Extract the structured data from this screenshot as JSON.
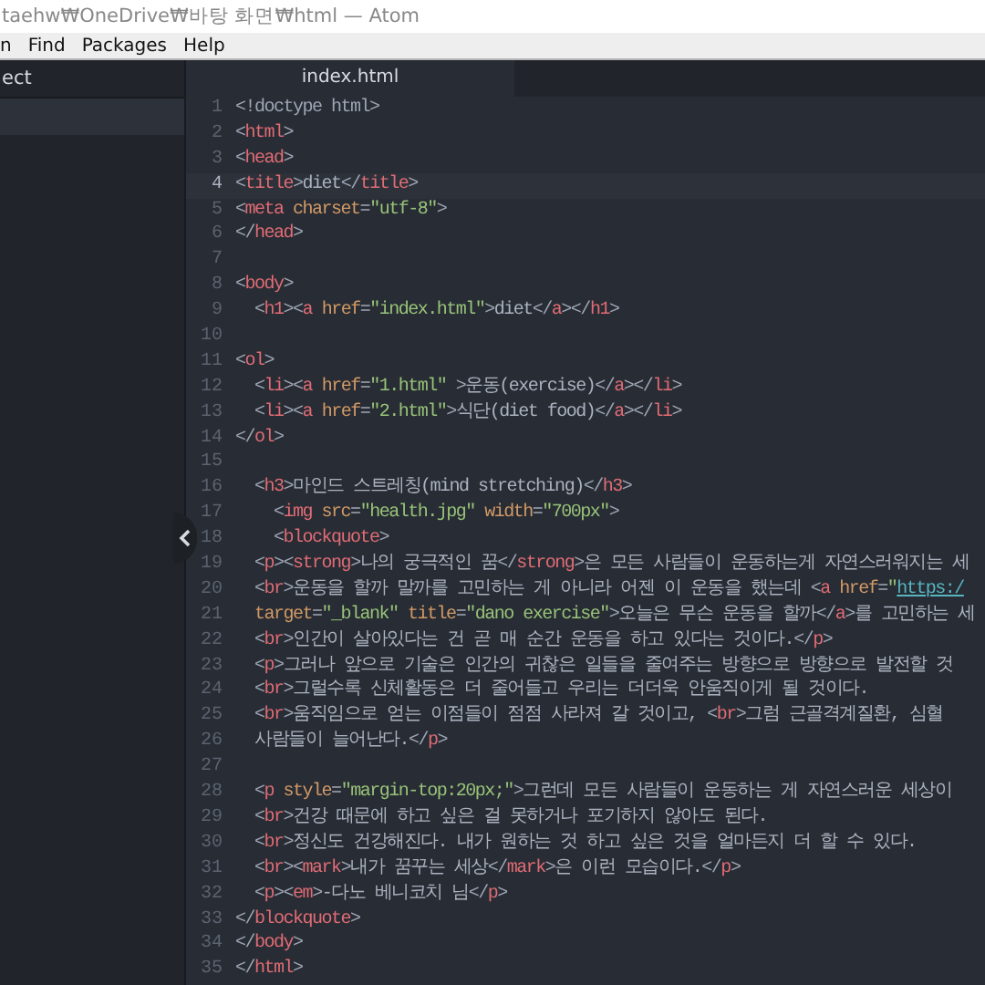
{
  "window": {
    "title": "taehw₩OneDrive₩바탕 화면₩html — Atom"
  },
  "menu": [
    "n",
    "Find",
    "Packages",
    "Help"
  ],
  "sidebar": {
    "header": "ect",
    "items": [
      {
        "selected": true
      }
    ]
  },
  "tabs": [
    {
      "label": "index.html",
      "selected": true
    }
  ],
  "editor": {
    "lines": [
      {
        "number": "1",
        "current": false,
        "tokens": [
          {
            "kind": "punct",
            "text": "<!doctype html>"
          }
        ]
      },
      {
        "number": "2",
        "current": false,
        "tokens": [
          {
            "kind": "punct",
            "text": "<"
          },
          {
            "kind": "tag",
            "text": "html"
          },
          {
            "kind": "punct",
            "text": ">"
          }
        ]
      },
      {
        "number": "3",
        "current": false,
        "tokens": [
          {
            "kind": "punct",
            "text": "<"
          },
          {
            "kind": "tag",
            "text": "head"
          },
          {
            "kind": "punct",
            "text": ">"
          }
        ]
      },
      {
        "number": "4",
        "current": true,
        "tokens": [
          {
            "kind": "punct",
            "text": "<"
          },
          {
            "kind": "tag",
            "text": "title"
          },
          {
            "kind": "punct",
            "text": ">"
          },
          {
            "kind": "text",
            "text": "diet"
          },
          {
            "kind": "punct",
            "text": "</"
          },
          {
            "kind": "tag",
            "text": "title"
          },
          {
            "kind": "punct",
            "text": ">"
          }
        ]
      },
      {
        "number": "5",
        "current": false,
        "tokens": [
          {
            "kind": "punct",
            "text": "<"
          },
          {
            "kind": "tag",
            "text": "meta"
          },
          {
            "kind": "attr",
            "text": " charset"
          },
          {
            "kind": "punct",
            "text": "="
          },
          {
            "kind": "string",
            "text": "\"utf-8\""
          },
          {
            "kind": "punct",
            "text": ">"
          }
        ]
      },
      {
        "number": "6",
        "current": false,
        "tokens": [
          {
            "kind": "punct",
            "text": "</"
          },
          {
            "kind": "tag",
            "text": "head"
          },
          {
            "kind": "punct",
            "text": ">"
          }
        ]
      },
      {
        "number": "7",
        "current": false
      },
      {
        "number": "8",
        "current": false,
        "tokens": [
          {
            "kind": "punct",
            "text": "<"
          },
          {
            "kind": "tag",
            "text": "body"
          },
          {
            "kind": "punct",
            "text": ">"
          }
        ]
      },
      {
        "number": "9",
        "current": false,
        "tokens": [
          {
            "kind": "punct",
            "text": "  <"
          },
          {
            "kind": "tag",
            "text": "h1"
          },
          {
            "kind": "punct",
            "text": "><"
          },
          {
            "kind": "tag",
            "text": "a"
          },
          {
            "kind": "attr",
            "text": " href"
          },
          {
            "kind": "punct",
            "text": "="
          },
          {
            "kind": "string",
            "text": "\"index.html\""
          },
          {
            "kind": "punct",
            "text": ">"
          },
          {
            "kind": "text",
            "text": "diet"
          },
          {
            "kind": "punct",
            "text": "</"
          },
          {
            "kind": "tag",
            "text": "a"
          },
          {
            "kind": "punct",
            "text": "></"
          },
          {
            "kind": "tag",
            "text": "h1"
          },
          {
            "kind": "punct",
            "text": ">"
          }
        ]
      },
      {
        "number": "10",
        "current": false
      },
      {
        "number": "11",
        "current": false,
        "tokens": [
          {
            "kind": "punct",
            "text": "<"
          },
          {
            "kind": "tag",
            "text": "ol"
          },
          {
            "kind": "punct",
            "text": ">"
          }
        ]
      },
      {
        "number": "12",
        "current": false,
        "tokens": [
          {
            "kind": "punct",
            "text": "  <"
          },
          {
            "kind": "tag",
            "text": "li"
          },
          {
            "kind": "punct",
            "text": "><"
          },
          {
            "kind": "tag",
            "text": "a"
          },
          {
            "kind": "attr",
            "text": " href"
          },
          {
            "kind": "punct",
            "text": "="
          },
          {
            "kind": "string",
            "text": "\"1.html\""
          },
          {
            "kind": "punct",
            "text": " >"
          },
          {
            "kind": "text",
            "text": "운동(exercise)"
          },
          {
            "kind": "punct",
            "text": "</"
          },
          {
            "kind": "tag",
            "text": "a"
          },
          {
            "kind": "punct",
            "text": "></"
          },
          {
            "kind": "tag",
            "text": "li"
          },
          {
            "kind": "punct",
            "text": ">"
          }
        ]
      },
      {
        "number": "13",
        "current": false,
        "tokens": [
          {
            "kind": "punct",
            "text": "  <"
          },
          {
            "kind": "tag",
            "text": "li"
          },
          {
            "kind": "punct",
            "text": "><"
          },
          {
            "kind": "tag",
            "text": "a"
          },
          {
            "kind": "attr",
            "text": " href"
          },
          {
            "kind": "punct",
            "text": "="
          },
          {
            "kind": "string",
            "text": "\"2.html\""
          },
          {
            "kind": "punct",
            "text": ">"
          },
          {
            "kind": "text",
            "text": "식단(diet food)"
          },
          {
            "kind": "punct",
            "text": "</"
          },
          {
            "kind": "tag",
            "text": "a"
          },
          {
            "kind": "punct",
            "text": "></"
          },
          {
            "kind": "tag",
            "text": "li"
          },
          {
            "kind": "punct",
            "text": ">"
          }
        ]
      },
      {
        "number": "14",
        "current": false,
        "tokens": [
          {
            "kind": "punct",
            "text": "</"
          },
          {
            "kind": "tag",
            "text": "ol"
          },
          {
            "kind": "punct",
            "text": ">"
          }
        ]
      },
      {
        "number": "15",
        "current": false
      },
      {
        "number": "16",
        "current": false,
        "tokens": [
          {
            "kind": "punct",
            "text": "  <"
          },
          {
            "kind": "tag",
            "text": "h3"
          },
          {
            "kind": "punct",
            "text": ">"
          },
          {
            "kind": "text",
            "text": "마인드 스트레칭(mind stretching)"
          },
          {
            "kind": "punct",
            "text": "</"
          },
          {
            "kind": "tag",
            "text": "h3"
          },
          {
            "kind": "punct",
            "text": ">"
          }
        ]
      },
      {
        "number": "17",
        "current": false,
        "tokens": [
          {
            "kind": "punct",
            "text": "    <"
          },
          {
            "kind": "tag",
            "text": "img"
          },
          {
            "kind": "attr",
            "text": " src"
          },
          {
            "kind": "punct",
            "text": "="
          },
          {
            "kind": "string",
            "text": "\"health.jpg\""
          },
          {
            "kind": "attr",
            "text": " width"
          },
          {
            "kind": "punct",
            "text": "="
          },
          {
            "kind": "string",
            "text": "\"700px\""
          },
          {
            "kind": "punct",
            "text": ">"
          }
        ]
      },
      {
        "number": "18",
        "current": false,
        "tokens": [
          {
            "kind": "punct",
            "text": "    <"
          },
          {
            "kind": "tag",
            "text": "blockquote"
          },
          {
            "kind": "punct",
            "text": ">"
          }
        ]
      },
      {
        "number": "19",
        "current": false,
        "tokens": [
          {
            "kind": "punct",
            "text": "  <"
          },
          {
            "kind": "tag",
            "text": "p"
          },
          {
            "kind": "punct",
            "text": "><"
          },
          {
            "kind": "tag",
            "text": "strong"
          },
          {
            "kind": "punct",
            "text": ">"
          },
          {
            "kind": "text",
            "text": "나의 궁극적인 꿈"
          },
          {
            "kind": "punct",
            "text": "</"
          },
          {
            "kind": "tag",
            "text": "strong"
          },
          {
            "kind": "punct",
            "text": ">"
          },
          {
            "kind": "text",
            "text": "은 모든 사람들이 운동하는게 자연스러워지는 세"
          }
        ]
      },
      {
        "number": "20",
        "current": false,
        "tokens": [
          {
            "kind": "punct",
            "text": "  <"
          },
          {
            "kind": "tag",
            "text": "br"
          },
          {
            "kind": "punct",
            "text": ">"
          },
          {
            "kind": "text",
            "text": "운동을 할까 말까를 고민하는 게 아니라 어젠 이 운동을 했는데 "
          },
          {
            "kind": "punct",
            "text": "<"
          },
          {
            "kind": "tag",
            "text": "a"
          },
          {
            "kind": "attr",
            "text": " href"
          },
          {
            "kind": "punct",
            "text": "="
          },
          {
            "kind": "string",
            "text": "\""
          },
          {
            "kind": "link",
            "text": "https:/"
          }
        ]
      },
      {
        "number": "21",
        "current": false,
        "tokens": [
          {
            "kind": "attr",
            "text": "  target"
          },
          {
            "kind": "punct",
            "text": "="
          },
          {
            "kind": "string",
            "text": "\"_blank\""
          },
          {
            "kind": "attr",
            "text": " title"
          },
          {
            "kind": "punct",
            "text": "="
          },
          {
            "kind": "string",
            "text": "\"dano exercise\""
          },
          {
            "kind": "punct",
            "text": ">"
          },
          {
            "kind": "text",
            "text": "오늘은 무슨 운동을 할까"
          },
          {
            "kind": "punct",
            "text": "</"
          },
          {
            "kind": "tag",
            "text": "a"
          },
          {
            "kind": "punct",
            "text": ">"
          },
          {
            "kind": "text",
            "text": "를 고민하는 세"
          }
        ]
      },
      {
        "number": "22",
        "current": false,
        "tokens": [
          {
            "kind": "punct",
            "text": "  <"
          },
          {
            "kind": "tag",
            "text": "br"
          },
          {
            "kind": "punct",
            "text": ">"
          },
          {
            "kind": "text",
            "text": "인간이 살아있다는 건 곧 매 순간 운동을 하고 있다는 것이다."
          },
          {
            "kind": "punct",
            "text": "</"
          },
          {
            "kind": "tag",
            "text": "p"
          },
          {
            "kind": "punct",
            "text": ">"
          }
        ]
      },
      {
        "number": "23",
        "current": false,
        "tokens": [
          {
            "kind": "punct",
            "text": "  <"
          },
          {
            "kind": "tag",
            "text": "p"
          },
          {
            "kind": "punct",
            "text": ">"
          },
          {
            "kind": "text",
            "text": "그러나 앞으로 기술은 인간의 귀찮은 일들을 줄여주는 방향으로 방향으로 발전할 것"
          }
        ]
      },
      {
        "number": "24",
        "current": false,
        "tokens": [
          {
            "kind": "punct",
            "text": "  <"
          },
          {
            "kind": "tag",
            "text": "br"
          },
          {
            "kind": "punct",
            "text": ">"
          },
          {
            "kind": "text",
            "text": "그럴수록 신체활동은 더 줄어들고 우리는 더더욱 안움직이게 될 것이다."
          }
        ]
      },
      {
        "number": "25",
        "current": false,
        "tokens": [
          {
            "kind": "punct",
            "text": "  <"
          },
          {
            "kind": "tag",
            "text": "br"
          },
          {
            "kind": "punct",
            "text": ">"
          },
          {
            "kind": "text",
            "text": "움직임으로 얻는 이점들이 점점 사라져 갈 것이고, "
          },
          {
            "kind": "punct",
            "text": "<"
          },
          {
            "kind": "tag",
            "text": "br"
          },
          {
            "kind": "punct",
            "text": ">"
          },
          {
            "kind": "text",
            "text": "그럼 근골격계질환, 심혈"
          }
        ]
      },
      {
        "number": "26",
        "current": false,
        "tokens": [
          {
            "kind": "text",
            "text": "  사람들이 늘어난다."
          },
          {
            "kind": "punct",
            "text": "</"
          },
          {
            "kind": "tag",
            "text": "p"
          },
          {
            "kind": "punct",
            "text": ">"
          }
        ]
      },
      {
        "number": "27",
        "current": false
      },
      {
        "number": "28",
        "current": false,
        "tokens": [
          {
            "kind": "punct",
            "text": "  <"
          },
          {
            "kind": "tag",
            "text": "p"
          },
          {
            "kind": "attr",
            "text": " style"
          },
          {
            "kind": "punct",
            "text": "="
          },
          {
            "kind": "string",
            "text": "\"margin-top:20px;\""
          },
          {
            "kind": "punct",
            "text": ">"
          },
          {
            "kind": "text",
            "text": "그런데 모든 사람들이 운동하는 게 자연스러운 세상이"
          }
        ]
      },
      {
        "number": "29",
        "current": false,
        "tokens": [
          {
            "kind": "punct",
            "text": "  <"
          },
          {
            "kind": "tag",
            "text": "br"
          },
          {
            "kind": "punct",
            "text": ">"
          },
          {
            "kind": "text",
            "text": "건강 때문에 하고 싶은 걸 못하거나 포기하지 않아도 된다."
          }
        ]
      },
      {
        "number": "30",
        "current": false,
        "tokens": [
          {
            "kind": "punct",
            "text": "  <"
          },
          {
            "kind": "tag",
            "text": "br"
          },
          {
            "kind": "punct",
            "text": ">"
          },
          {
            "kind": "text",
            "text": "정신도 건강해진다. 내가 원하는 것 하고 싶은 것을 얼마든지 더 할 수 있다."
          }
        ]
      },
      {
        "number": "31",
        "current": false,
        "tokens": [
          {
            "kind": "punct",
            "text": "  <"
          },
          {
            "kind": "tag",
            "text": "br"
          },
          {
            "kind": "punct",
            "text": "><"
          },
          {
            "kind": "tag",
            "text": "mark"
          },
          {
            "kind": "punct",
            "text": ">"
          },
          {
            "kind": "text",
            "text": "내가 꿈꾸는 세상"
          },
          {
            "kind": "punct",
            "text": "</"
          },
          {
            "kind": "tag",
            "text": "mark"
          },
          {
            "kind": "punct",
            "text": ">"
          },
          {
            "kind": "text",
            "text": "은 이런 모습이다."
          },
          {
            "kind": "punct",
            "text": "</"
          },
          {
            "kind": "tag",
            "text": "p"
          },
          {
            "kind": "punct",
            "text": ">"
          }
        ]
      },
      {
        "number": "32",
        "current": false,
        "tokens": [
          {
            "kind": "punct",
            "text": "  <"
          },
          {
            "kind": "tag",
            "text": "p"
          },
          {
            "kind": "punct",
            "text": "><"
          },
          {
            "kind": "tag",
            "text": "em"
          },
          {
            "kind": "punct",
            "text": ">"
          },
          {
            "kind": "text",
            "text": "-다노 베니코치 님"
          },
          {
            "kind": "punct",
            "text": "</"
          },
          {
            "kind": "tag",
            "text": "p"
          },
          {
            "kind": "punct",
            "text": ">"
          }
        ]
      },
      {
        "number": "33",
        "current": false,
        "tokens": [
          {
            "kind": "punct",
            "text": "</"
          },
          {
            "kind": "tag",
            "text": "blockquote"
          },
          {
            "kind": "punct",
            "text": ">"
          }
        ]
      },
      {
        "number": "34",
        "current": false,
        "tokens": [
          {
            "kind": "punct",
            "text": "</"
          },
          {
            "kind": "tag",
            "text": "body"
          },
          {
            "kind": "punct",
            "text": ">"
          }
        ]
      },
      {
        "number": "35",
        "current": false,
        "tokens": [
          {
            "kind": "punct",
            "text": "</"
          },
          {
            "kind": "tag",
            "text": "html"
          },
          {
            "kind": "punct",
            "text": ">"
          }
        ]
      }
    ]
  }
}
